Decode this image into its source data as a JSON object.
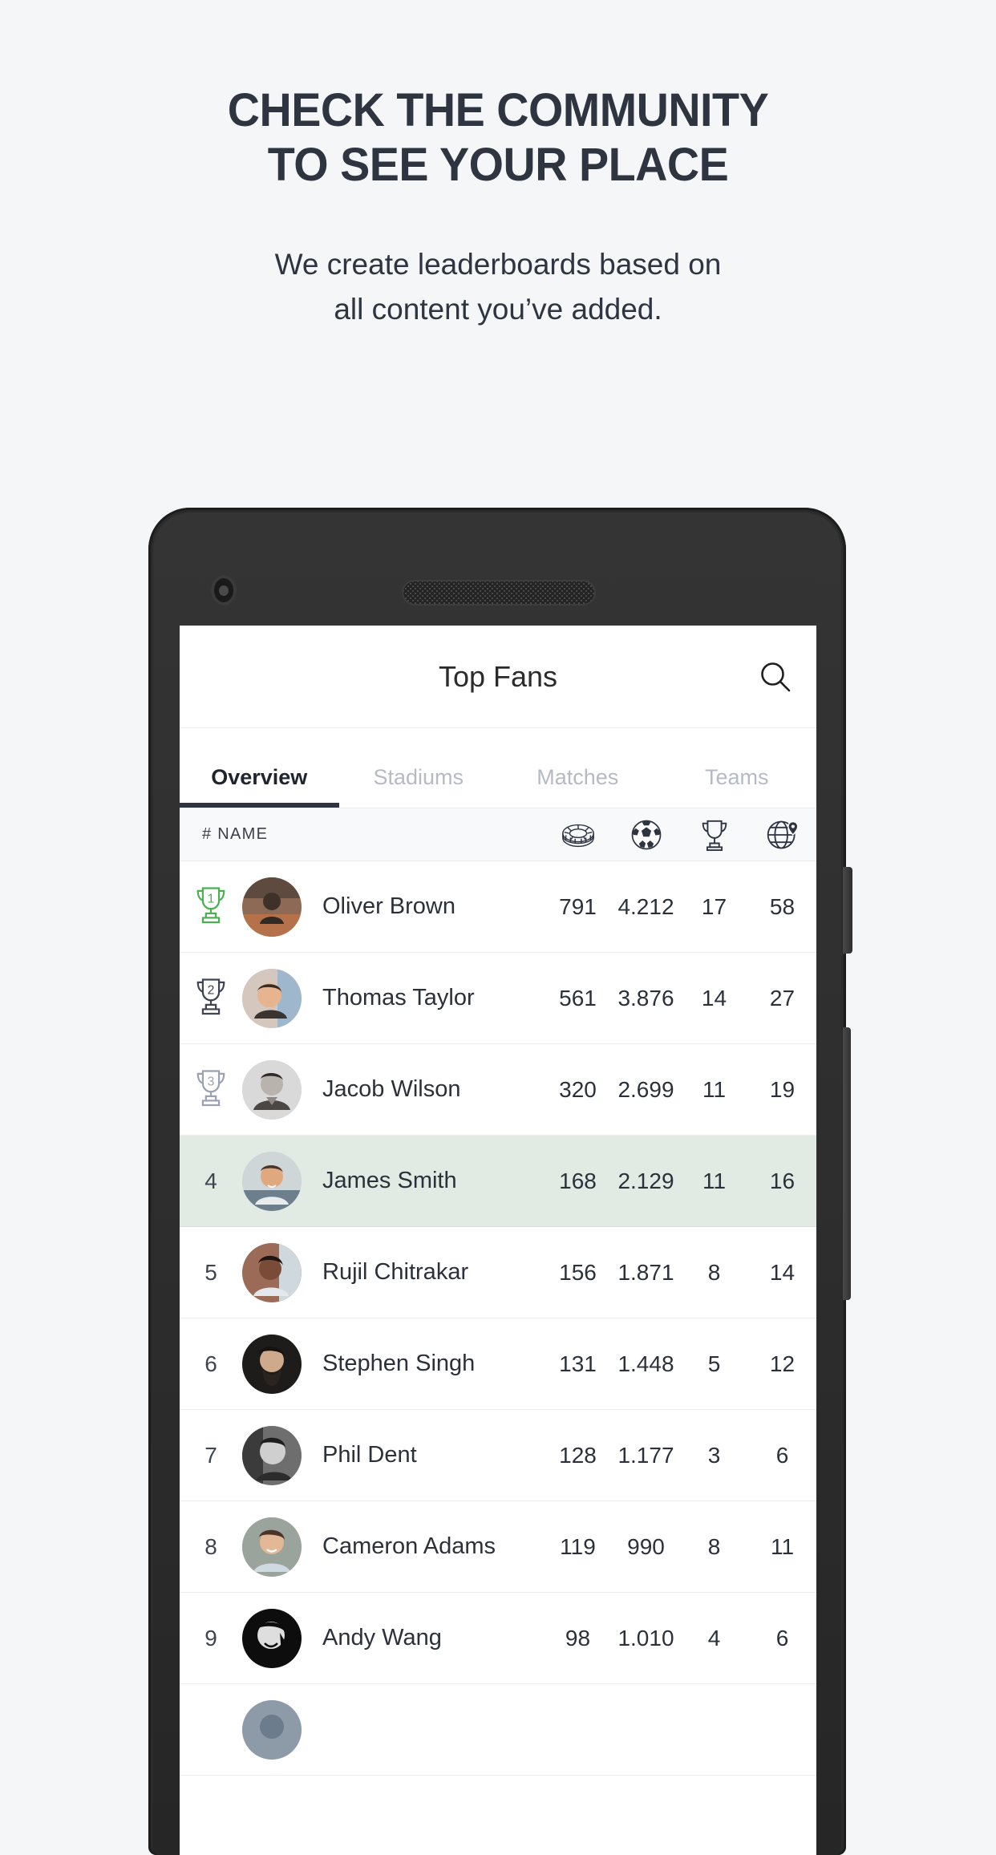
{
  "promo": {
    "title_line1": "CHECK THE COMMUNITY",
    "title_line2": "TO SEE YOUR PLACE",
    "subtitle_line1": "We create leaderboards based on",
    "subtitle_line2": "all content you’ve added."
  },
  "colors": {
    "page_background": "#f5f6f7",
    "heading": "#2e3440",
    "accent_dark": "#2e3440",
    "highlight_row": "#e1ebe4",
    "rank1_trophy": "#4caf50",
    "tab_inactive": "#b6bac4"
  },
  "app": {
    "title": "Top Fans",
    "search_icon": "search-icon",
    "tabs": [
      {
        "label": "Overview",
        "active": true
      },
      {
        "label": "Stadiums",
        "active": false
      },
      {
        "label": "Matches",
        "active": false
      },
      {
        "label": "Teams",
        "active": false
      }
    ],
    "table": {
      "header_label": "# NAME",
      "column_icons": [
        "stadium-icon",
        "soccer-ball-icon",
        "trophy-icon",
        "globe-pin-icon"
      ],
      "rows": [
        {
          "rank": "1",
          "medal": "gold",
          "name": "Oliver Brown",
          "stadiums": "791",
          "matches": "4.212",
          "trophies": "17",
          "places": "58",
          "highlight": false
        },
        {
          "rank": "2",
          "medal": "silver",
          "name": "Thomas Taylor",
          "stadiums": "561",
          "matches": "3.876",
          "trophies": "14",
          "places": "27",
          "highlight": false
        },
        {
          "rank": "3",
          "medal": "bronze",
          "name": "Jacob Wilson",
          "stadiums": "320",
          "matches": "2.699",
          "trophies": "11",
          "places": "19",
          "highlight": false
        },
        {
          "rank": "4",
          "medal": "",
          "name": "James Smith",
          "stadiums": "168",
          "matches": "2.129",
          "trophies": "11",
          "places": "16",
          "highlight": true
        },
        {
          "rank": "5",
          "medal": "",
          "name": "Rujil Chitrakar",
          "stadiums": "156",
          "matches": "1.871",
          "trophies": "8",
          "places": "14",
          "highlight": false
        },
        {
          "rank": "6",
          "medal": "",
          "name": "Stephen Singh",
          "stadiums": "131",
          "matches": "1.448",
          "trophies": "5",
          "places": "12",
          "highlight": false
        },
        {
          "rank": "7",
          "medal": "",
          "name": "Phil Dent",
          "stadiums": "128",
          "matches": "1.177",
          "trophies": "3",
          "places": "6",
          "highlight": false
        },
        {
          "rank": "8",
          "medal": "",
          "name": "Cameron Adams",
          "stadiums": "119",
          "matches": "990",
          "trophies": "8",
          "places": "11",
          "highlight": false
        },
        {
          "rank": "9",
          "medal": "",
          "name": "Andy Wang",
          "stadiums": "98",
          "matches": "1.010",
          "trophies": "4",
          "places": "6",
          "highlight": false
        }
      ]
    }
  },
  "device": {
    "camera": "front-camera",
    "speaker": "earpiece-speaker",
    "power_button": "power-button",
    "volume_button": "volume-button"
  }
}
